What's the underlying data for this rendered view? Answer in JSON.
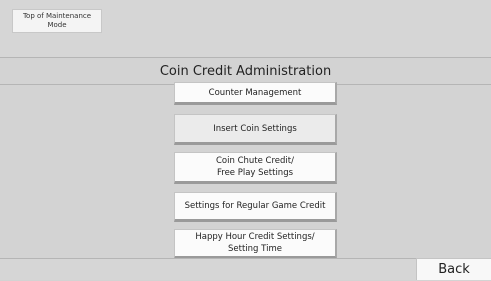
{
  "header": {
    "top_button_label": "Top of Maintenance\nMode"
  },
  "page": {
    "title": "Coin Credit Administration"
  },
  "menu": [
    {
      "label": "Counter Management"
    },
    {
      "label": "Insert Coin Settings"
    },
    {
      "label": "Coin Chute Credit/\nFree Play Settings"
    },
    {
      "label": "Settings for Regular Game Credit"
    },
    {
      "label": "Happy Hour Credit Settings/\nSetting Time"
    }
  ],
  "footer": {
    "back_label": "Back"
  }
}
